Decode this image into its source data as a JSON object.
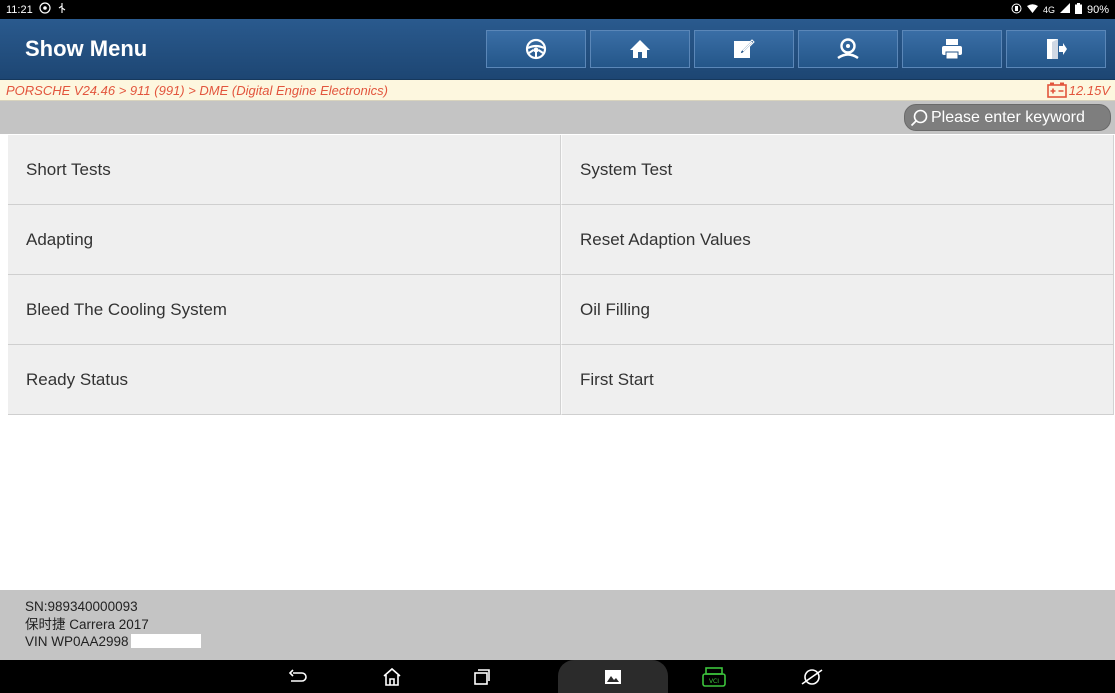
{
  "status_bar": {
    "time": "11:21",
    "network": "4G",
    "battery": "90%"
  },
  "header": {
    "title": "Show Menu",
    "toolbar": [
      {
        "icon": "steering-wheel-icon"
      },
      {
        "icon": "home-icon"
      },
      {
        "icon": "edit-report-icon"
      },
      {
        "icon": "user-icon"
      },
      {
        "icon": "print-icon"
      },
      {
        "icon": "exit-icon"
      }
    ]
  },
  "breadcrumb": {
    "path": "PORSCHE V24.46 > 911 (991) > DME (Digital Engine Electronics)",
    "voltage": "12.15V",
    "accent_color": "#e2553d"
  },
  "search": {
    "placeholder": "Please enter keyword"
  },
  "menu": {
    "items": [
      {
        "label": "Short Tests"
      },
      {
        "label": "System Test"
      },
      {
        "label": "Adapting"
      },
      {
        "label": "Reset Adaption Values"
      },
      {
        "label": "Bleed The Cooling System"
      },
      {
        "label": "Oil Filling"
      },
      {
        "label": "Ready Status"
      },
      {
        "label": "First Start"
      }
    ]
  },
  "footer": {
    "serial": "SN:989340000093",
    "vehicle": "保时捷 Carrera 2017",
    "vin": "VIN WP0AA2998"
  },
  "nav_bar": {
    "items": [
      "back-icon",
      "home-icon",
      "recents-icon",
      "gallery-icon",
      "vci-icon",
      "browser-icon"
    ],
    "vci_color": "#3cc43c"
  }
}
